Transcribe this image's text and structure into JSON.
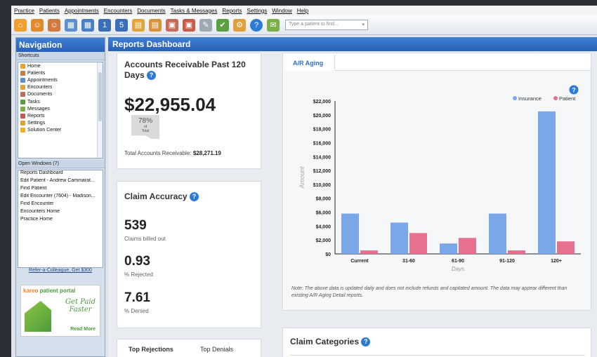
{
  "menu": [
    "Practice",
    "Patients",
    "Appointments",
    "Encounters",
    "Documents",
    "Tasks & Messages",
    "Reports",
    "Settings",
    "Window",
    "Help"
  ],
  "toolbar": {
    "search_placeholder": "Type a patient to find..."
  },
  "navigation": {
    "title": "Navigation",
    "shortcuts_label": "Shortcuts",
    "shortcuts": [
      "Home",
      "Patients",
      "Appointments",
      "Encounters",
      "Documents",
      "Tasks",
      "Messages",
      "Reports",
      "Settings",
      "Solution Center"
    ],
    "open_windows_label": "Open Windows (7)",
    "open_windows": [
      "Reports Dashboard",
      "Edit Patient - Andrew Cammarat...",
      "Find Patient",
      "Edit Encounter (7604) - Madison...",
      "Find Encounter",
      "Encounters Home",
      "Practice Home"
    ],
    "refer_link": "Refer-a-Colleague, Get $300",
    "ad": {
      "brand": "kareo",
      "brand_suffix": "patient portal",
      "line1": "Get Paid",
      "line2": "Faster",
      "cta": "Read More"
    }
  },
  "dashboard": {
    "title": "Reports Dashboard",
    "ar": {
      "title": "Accounts Receivable Past 120 Days",
      "amount": "$22,955.04",
      "pct": "78%",
      "pct_of": "of",
      "pct_total": "Total",
      "total_label": "Total Accounts Receivable:",
      "total_value": "$28,271.19"
    },
    "claim_accuracy": {
      "title": "Claim Accuracy",
      "billed": "539",
      "billed_label": "Claims billed out",
      "rejected": "0.93",
      "rejected_label": "% Rejected",
      "denied": "7.61",
      "denied_label": "% Denied"
    },
    "bottom_tabs": [
      "Top Rejections",
      "Top Denials"
    ],
    "chart_tab": "A/R Aging",
    "chart_note": "Note: The above data is updated daily and does not include refunds and capitated amount. The data may appear different than existing A/R Aging Detail reports.",
    "claim_categories_title": "Claim Categories",
    "help": "?"
  },
  "colors": {
    "insurance": "#7aa7e8",
    "patient": "#e8708f",
    "header": "#2e6fc4"
  },
  "chart_data": {
    "type": "bar",
    "categories": [
      "Current",
      "31-60",
      "61-90",
      "91-120",
      "120+"
    ],
    "series": [
      {
        "name": "Insurance",
        "values": [
          5800,
          4500,
          1500,
          5800,
          20500
        ]
      },
      {
        "name": "Patient",
        "values": [
          500,
          3000,
          2300,
          500,
          1800
        ]
      }
    ],
    "xlabel": "Days",
    "ylabel": "Amount",
    "ylim": [
      0,
      22000
    ],
    "yticks": [
      "$0",
      "$2,000",
      "$4,000",
      "$6,000",
      "$8,000",
      "$10,000",
      "$12,000",
      "$14,000",
      "$16,000",
      "$18,000",
      "$20,000",
      "$22,000"
    ],
    "legend": "top-right"
  }
}
